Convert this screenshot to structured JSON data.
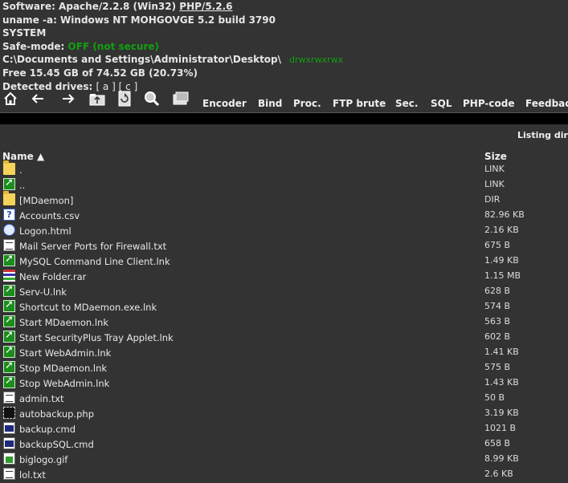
{
  "info": {
    "software_prefix": "Software: Apache/2.2.8 (Win32) ",
    "software_php": "PHP/5.2.6",
    "uname": "uname -a: Windows NT MOHGOVGE 5.2 build 3790",
    "user": "SYSTEM",
    "safe_mode_label": "Safe-mode: ",
    "safe_mode_value": "OFF (not secure)",
    "path": "C:\\Documents and Settings\\Administrator\\Desktop\\",
    "permissions": "drwxrwxrwx",
    "free_space": "Free 15.45 GB of 74.52 GB (20.73%)",
    "drives_label": "Detected drives: ",
    "drives": "[ a ] [ c ]"
  },
  "toolbar": {
    "icons": [
      "home-icon",
      "back-arrow-icon",
      "forward-arrow-icon",
      "up-folder-icon",
      "refresh-icon",
      "search-icon",
      "buffer-icon"
    ],
    "items": [
      "Encoder",
      "Bind",
      "Proc.",
      "FTP brute",
      "Sec.",
      "SQL",
      "PHP-code",
      "Feedback"
    ]
  },
  "listing_label": "Listing dir",
  "table": {
    "name_header": "Name ▲",
    "size_header": "Size",
    "rows": [
      {
        "icon": "folder",
        "name": ".",
        "size": "LINK"
      },
      {
        "icon": "lnk",
        "name": "..",
        "size": "LINK"
      },
      {
        "icon": "folder",
        "name": "[MDaemon]",
        "size": "DIR"
      },
      {
        "icon": "q",
        "name": "Accounts.csv",
        "size": "82.96 KB"
      },
      {
        "icon": "html",
        "name": "Logon.html",
        "size": "2.16 KB"
      },
      {
        "icon": "txt",
        "name": "Mail Server Ports for Firewall.txt",
        "size": "675 B"
      },
      {
        "icon": "lnk",
        "name": "MySQL Command Line Client.lnk",
        "size": "1.49 KB"
      },
      {
        "icon": "rar",
        "name": "New Folder.rar",
        "size": "1.15 MB"
      },
      {
        "icon": "lnk",
        "name": "Serv-U.lnk",
        "size": "628 B"
      },
      {
        "icon": "lnk",
        "name": "Shortcut to MDaemon.exe.lnk",
        "size": "574 B"
      },
      {
        "icon": "lnk",
        "name": "Start MDaemon.lnk",
        "size": "563 B"
      },
      {
        "icon": "lnk",
        "name": "Start SecurityPlus Tray Applet.lnk",
        "size": "602 B"
      },
      {
        "icon": "lnk",
        "name": "Start WebAdmin.lnk",
        "size": "1.41 KB"
      },
      {
        "icon": "lnk",
        "name": "Stop MDaemon.lnk",
        "size": "575 B"
      },
      {
        "icon": "lnk",
        "name": "Stop WebAdmin.lnk",
        "size": "1.43 KB"
      },
      {
        "icon": "txt",
        "name": "admin.txt",
        "size": "50 B"
      },
      {
        "icon": "php",
        "name": "autobackup.php",
        "size": "3.19 KB"
      },
      {
        "icon": "cmd",
        "name": "backup.cmd",
        "size": "1021 B"
      },
      {
        "icon": "cmd",
        "name": "backupSQL.cmd",
        "size": "658 B"
      },
      {
        "icon": "gif",
        "name": "biglogo.gif",
        "size": "8.99 KB"
      },
      {
        "icon": "txt",
        "name": "lol.txt",
        "size": "2.6 KB"
      }
    ]
  }
}
